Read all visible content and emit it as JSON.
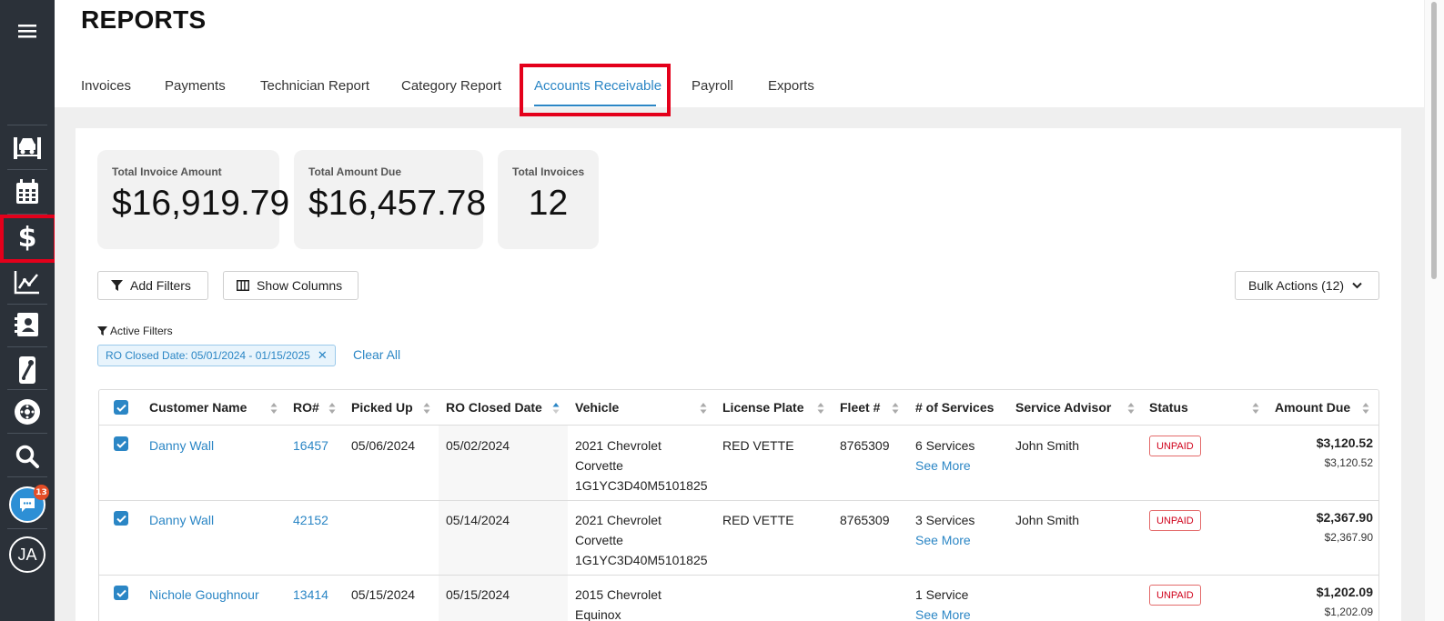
{
  "page": {
    "title": "REPORTS"
  },
  "tabs": [
    {
      "label": "Invoices",
      "active": false
    },
    {
      "label": "Payments",
      "active": false
    },
    {
      "label": "Technician Report",
      "active": false
    },
    {
      "label": "Category Report",
      "active": false
    },
    {
      "label": "Accounts Receivable",
      "active": true
    },
    {
      "label": "Payroll",
      "active": false
    },
    {
      "label": "Exports",
      "active": false
    }
  ],
  "sidebar": {
    "items": [
      {
        "icon": "menu-icon"
      },
      {
        "icon": "shop-lift-icon"
      },
      {
        "icon": "calendar-icon"
      },
      {
        "icon": "dollar-icon",
        "active": true
      },
      {
        "icon": "reports-chart-icon"
      },
      {
        "icon": "contacts-icon"
      },
      {
        "icon": "inventory-tools-icon"
      },
      {
        "icon": "tire-icon"
      },
      {
        "icon": "search-icon"
      }
    ],
    "chat_badge": "13",
    "user_initials": "JA"
  },
  "stats": [
    {
      "label": "Total Invoice Amount",
      "value": "$16,919.79"
    },
    {
      "label": "Total Amount Due",
      "value": "$16,457.78"
    },
    {
      "label": "Total Invoices",
      "value": "12"
    }
  ],
  "toolbar": {
    "add_filters": "Add Filters",
    "show_columns": "Show Columns",
    "bulk_actions": "Bulk Actions (12)"
  },
  "filters": {
    "active_label": "Active Filters",
    "chip": "RO Closed Date: 05/01/2024 - 01/15/2025",
    "clear_all": "Clear All"
  },
  "table": {
    "columns": [
      "Customer Name",
      "RO#",
      "Picked Up",
      "RO Closed Date",
      "Vehicle",
      "License Plate",
      "Fleet #",
      "# of Services",
      "Service Advisor",
      "Status",
      "Amount Due"
    ],
    "rows": [
      {
        "customer": "Danny Wall",
        "ro": "16457",
        "picked_up": "05/06/2024",
        "closed": "05/02/2024",
        "vehicle_line1": "2021 Chevrolet",
        "vehicle_line2": "Corvette",
        "vehicle_line3": "1G1YC3D40M5101825",
        "plate": "RED VETTE",
        "fleet": "8765309",
        "services": "6 Services",
        "see_more": "See More",
        "advisor": "John Smith",
        "status": "UNPAID",
        "amount": "$3,120.52",
        "amount_sub": "$3,120.52"
      },
      {
        "customer": "Danny Wall",
        "ro": "42152",
        "picked_up": "",
        "closed": "05/14/2024",
        "vehicle_line1": "2021 Chevrolet",
        "vehicle_line2": "Corvette",
        "vehicle_line3": "1G1YC3D40M5101825",
        "plate": "RED VETTE",
        "fleet": "8765309",
        "services": "3 Services",
        "see_more": "See More",
        "advisor": "John Smith",
        "status": "UNPAID",
        "amount": "$2,367.90",
        "amount_sub": "$2,367.90"
      },
      {
        "customer": "Nichole Goughnour",
        "ro": "13414",
        "picked_up": "05/15/2024",
        "closed": "05/15/2024",
        "vehicle_line1": "2015 Chevrolet",
        "vehicle_line2": "Equinox",
        "vehicle_line3": "",
        "plate": "",
        "fleet": "",
        "services": "1 Service",
        "see_more": "See More",
        "advisor": "",
        "status": "UNPAID",
        "amount": "$1,202.09",
        "amount_sub": "$1,202.09"
      }
    ]
  }
}
